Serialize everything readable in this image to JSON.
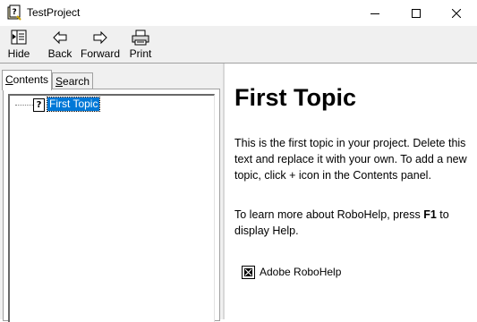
{
  "window": {
    "title": "TestProject"
  },
  "toolbar": {
    "hide_label": "Hide",
    "back_label": "Back",
    "forward_label": "Forward",
    "print_label": "Print"
  },
  "nav": {
    "tabs": [
      {
        "label": "Contents",
        "underline_char": "C",
        "rest": "ontents"
      },
      {
        "label": "Search",
        "underline_char": "S",
        "rest": "earch"
      }
    ],
    "tree": [
      {
        "label": "First Topic",
        "icon": "help-topic-icon"
      }
    ]
  },
  "content": {
    "title": "First Topic",
    "para1": "This is the first topic in your project. Delete this text and replace it with your own. To add a new topic, click + icon in the Contents panel.",
    "para2_before": "To learn more about RoboHelp, press ",
    "para2_key": "F1",
    "para2_after": " to display Help.",
    "brand_label": "Adobe RoboHelp"
  },
  "colors": {
    "selection": "#0078d7",
    "toolbar_bg": "#f0f0f0"
  }
}
